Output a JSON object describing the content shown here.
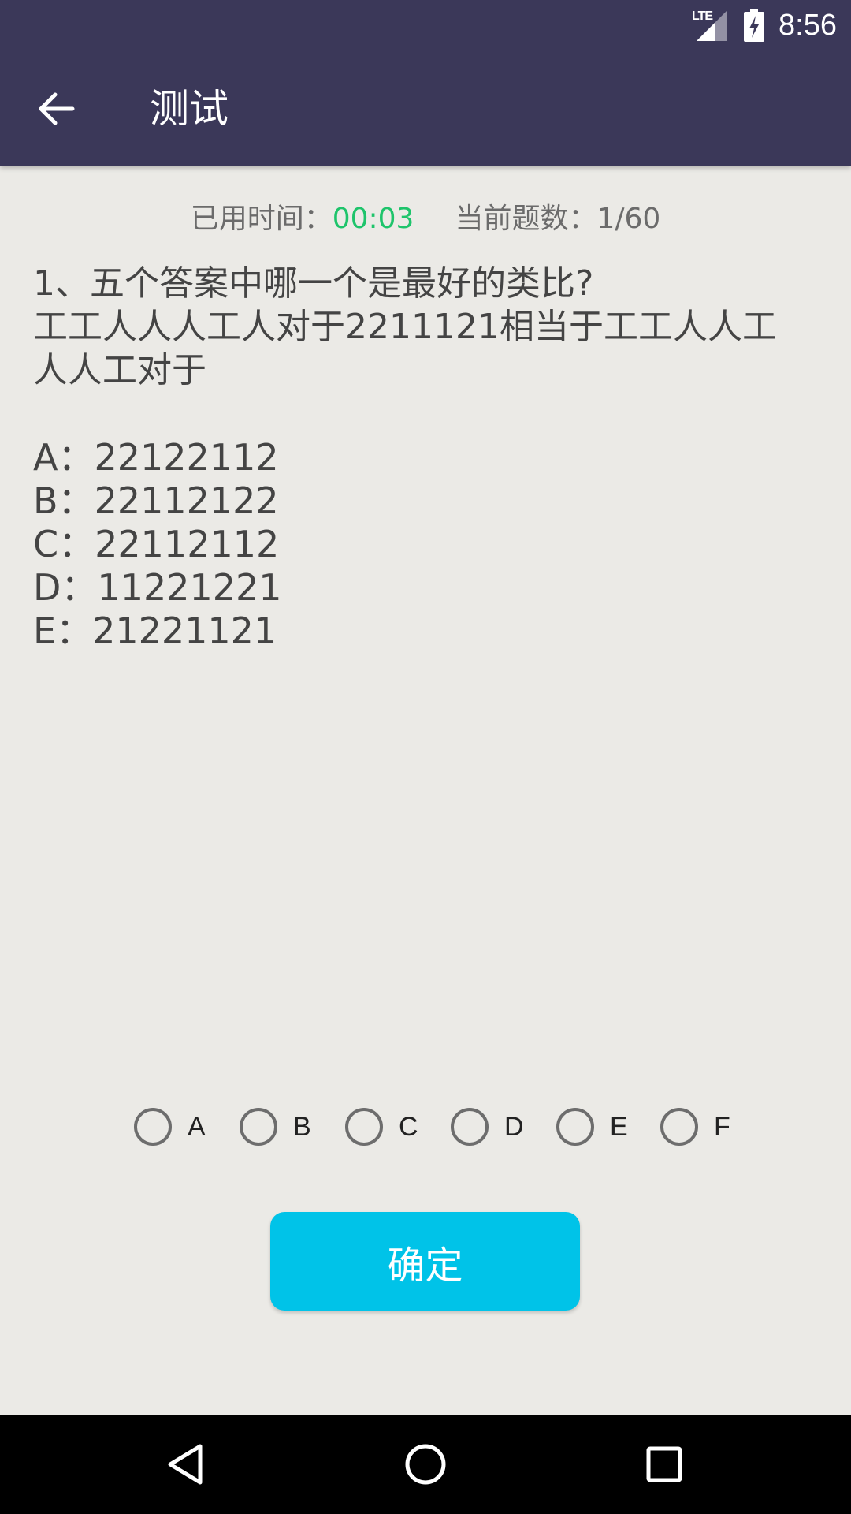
{
  "status_bar": {
    "network_label": "LTE",
    "time": "8:56"
  },
  "app_bar": {
    "back_icon": "arrow-left-icon",
    "title": "测试"
  },
  "info": {
    "elapsed_label": "已用时间：",
    "elapsed_value": "00:03",
    "count_label": "当前题数：",
    "count_value": "1/60",
    "timer_color": "#1ec46b"
  },
  "question": {
    "line1": "1、五个答案中哪一个是最好的类比?",
    "line2": "工工人人人工人对于2211121相当于工工人人工",
    "line3": "人人工对于"
  },
  "options": [
    {
      "label": "A：",
      "value": "22122112"
    },
    {
      "label": "B：",
      "value": "22112122"
    },
    {
      "label": "C：",
      "value": "22112112"
    },
    {
      "label": "D：",
      "value": "11221221"
    },
    {
      "label": "E：",
      "value": "21221121"
    }
  ],
  "choices": [
    "A",
    "B",
    "C",
    "D",
    "E",
    "F"
  ],
  "confirm_button": {
    "label": "确定",
    "color": "#00c3e8"
  },
  "nav_bar": {
    "back_icon": "nav-back-triangle-icon",
    "home_icon": "nav-home-circle-icon",
    "recents_icon": "nav-recents-square-icon"
  },
  "colors": {
    "app_bar": "#3b3859",
    "background": "#ebeae6"
  }
}
